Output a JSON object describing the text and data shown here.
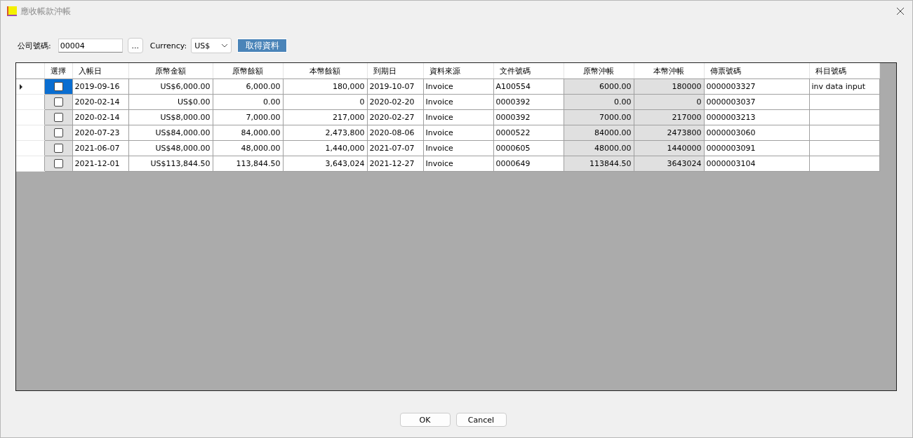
{
  "window": {
    "title": "應收帳款沖帳"
  },
  "toolbar": {
    "company_label": "公司號碼:",
    "company_value": "00004",
    "browse_button": "...",
    "currency_label": "Currency:",
    "currency_value": "US$",
    "fetch_button": "取得資料"
  },
  "table": {
    "columns": [
      {
        "label": "選擇",
        "kind": "check",
        "readonly": true
      },
      {
        "label": "入帳日",
        "kind": "text",
        "readonly": false
      },
      {
        "label": "原幣金額",
        "kind": "number",
        "readonly": false
      },
      {
        "label": "原幣餘額",
        "kind": "number",
        "readonly": false
      },
      {
        "label": "本幣餘額",
        "kind": "number",
        "readonly": false
      },
      {
        "label": "到期日",
        "kind": "text",
        "readonly": false
      },
      {
        "label": "資料來源",
        "kind": "text",
        "readonly": false
      },
      {
        "label": "文件號碼",
        "kind": "text",
        "readonly": false
      },
      {
        "label": "原幣沖帳",
        "kind": "number",
        "readonly": true
      },
      {
        "label": "本幣沖帳",
        "kind": "number",
        "readonly": true
      },
      {
        "label": "傳票號碼",
        "kind": "text",
        "readonly": false
      },
      {
        "label": "科目號碼",
        "kind": "text",
        "readonly": false
      }
    ],
    "rows": [
      {
        "selected": true,
        "checked": false,
        "cells": [
          "",
          "2019-09-16",
          "US$6,000.00",
          "6,000.00",
          "180,000",
          "2019-10-07",
          "Invoice",
          "A100554",
          "6000.00",
          "180000",
          "0000003327",
          "inv data input"
        ]
      },
      {
        "selected": false,
        "checked": false,
        "cells": [
          "",
          "2020-02-14",
          "US$0.00",
          "0.00",
          "0",
          "2020-02-20",
          "Invoice",
          "0000392",
          "0.00",
          "0",
          "0000003037",
          ""
        ]
      },
      {
        "selected": false,
        "checked": false,
        "cells": [
          "",
          "2020-02-14",
          "US$8,000.00",
          "7,000.00",
          "217,000",
          "2020-02-27",
          "Invoice",
          "0000392",
          "7000.00",
          "217000",
          "0000003213",
          ""
        ]
      },
      {
        "selected": false,
        "checked": false,
        "cells": [
          "",
          "2020-07-23",
          "US$84,000.00",
          "84,000.00",
          "2,473,800",
          "2020-08-06",
          "Invoice",
          "0000522",
          "84000.00",
          "2473800",
          "0000003060",
          ""
        ]
      },
      {
        "selected": false,
        "checked": false,
        "cells": [
          "",
          "2021-06-07",
          "US$48,000.00",
          "48,000.00",
          "1,440,000",
          "2021-07-07",
          "Invoice",
          "0000605",
          "48000.00",
          "1440000",
          "0000003091",
          ""
        ]
      },
      {
        "selected": false,
        "checked": false,
        "cells": [
          "",
          "2021-12-01",
          "US$113,844.50",
          "113,844.50",
          "3,643,024",
          "2021-12-27",
          "Invoice",
          "0000649",
          "113844.50",
          "3643024",
          "0000003104",
          ""
        ]
      }
    ]
  },
  "buttons": [
    "OK",
    "Cancel"
  ]
}
